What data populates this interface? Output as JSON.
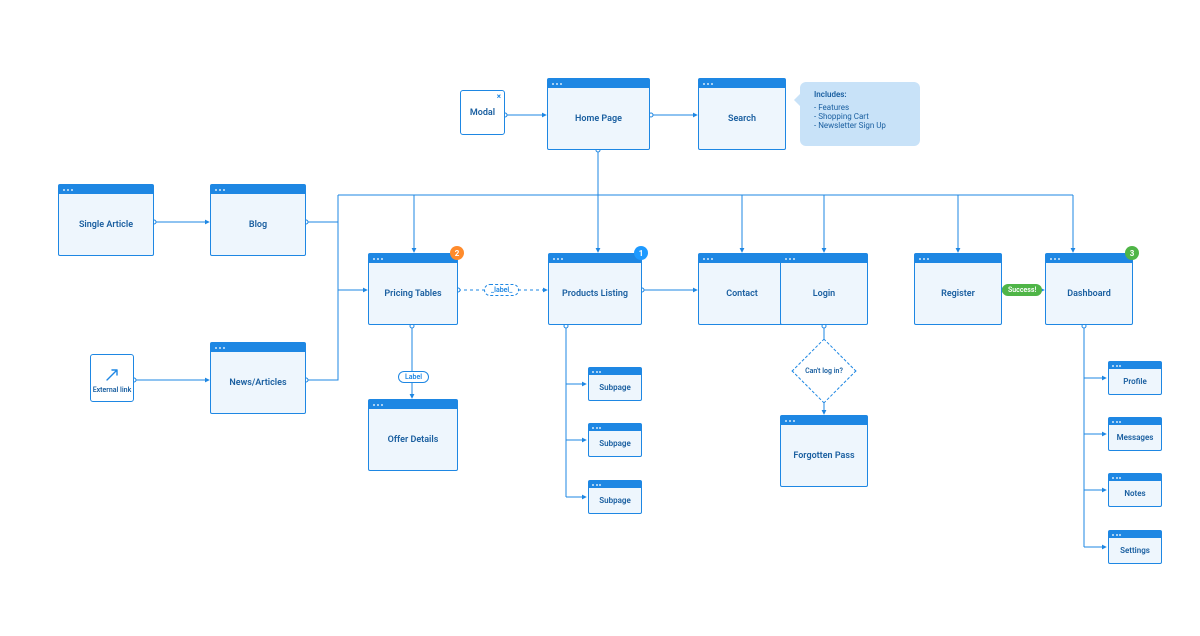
{
  "nodes": {
    "home": {
      "label": "Home Page"
    },
    "search": {
      "label": "Search"
    },
    "modal": {
      "label": "Modal"
    },
    "single_article": {
      "label": "Single Article"
    },
    "blog": {
      "label": "Blog"
    },
    "news": {
      "label": "News/Articles"
    },
    "external": {
      "label": "External link"
    },
    "pricing": {
      "label": "Pricing Tables"
    },
    "offer": {
      "label": "Offer Details"
    },
    "products": {
      "label": "Products Listing"
    },
    "sub1": {
      "label": "Subpage"
    },
    "sub2": {
      "label": "Subpage"
    },
    "sub3": {
      "label": "Subpage"
    },
    "contact": {
      "label": "Contact"
    },
    "login": {
      "label": "Login"
    },
    "forgotten": {
      "label": "Forgotten Pass"
    },
    "register": {
      "label": "Register"
    },
    "dashboard": {
      "label": "Dashboard"
    },
    "profile": {
      "label": "Profile"
    },
    "messages": {
      "label": "Messages"
    },
    "notes": {
      "label": "Notes"
    },
    "settings": {
      "label": "Settings"
    },
    "decision": {
      "label": "Can't log in?"
    }
  },
  "callout": {
    "title": "Includes:",
    "items": [
      "- Features",
      "- Shopping Cart",
      "- Newsletter Sign Up"
    ]
  },
  "badges": {
    "pricing": "2",
    "products": "1",
    "dashboard": "3"
  },
  "labels": {
    "success": "Success!",
    "label_pill": "Label",
    "dashed_pill": "_label_"
  }
}
